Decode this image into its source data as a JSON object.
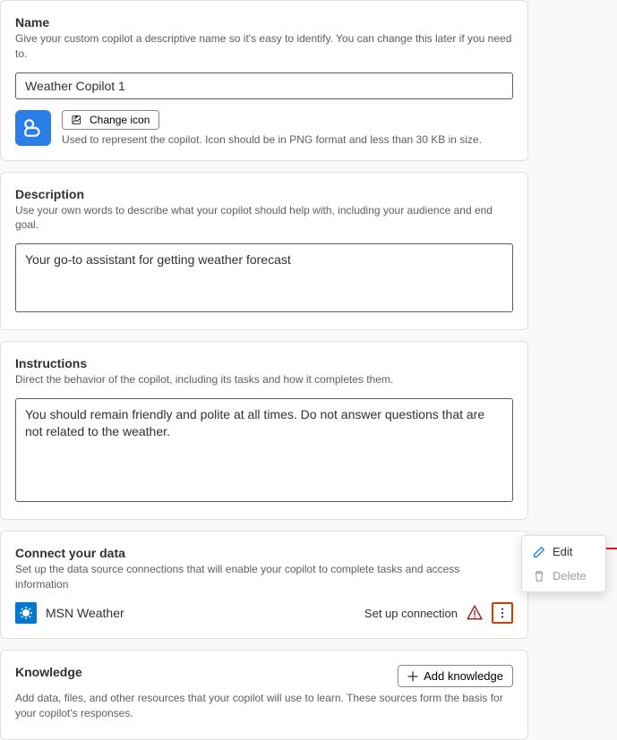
{
  "name_section": {
    "title": "Name",
    "desc": "Give your custom copilot a descriptive name so it's easy to identify. You can change this later if you need to.",
    "value": "Weather Copilot 1",
    "change_icon_label": "Change icon",
    "icon_note": "Used to represent the copilot. Icon should be in PNG format and less than 30 KB in size."
  },
  "description_section": {
    "title": "Description",
    "desc": "Use your own words to describe what your copilot should help with, including your audience and end goal.",
    "value": "Your go-to assistant for getting weather forecast"
  },
  "instructions_section": {
    "title": "Instructions",
    "desc": "Direct the behavior of the copilot, including its tasks and how it completes them.",
    "value": "You should remain friendly and polite at all times. Do not answer questions that are not related to the weather."
  },
  "connect_section": {
    "title": "Connect your data",
    "desc": "Set up the data source connections that will enable your copilot to complete tasks and access information",
    "item_label": "MSN Weather",
    "status": "Set up connection"
  },
  "knowledge_section": {
    "title": "Knowledge",
    "desc": "Add data, files, and other resources that your copilot will use to learn. These sources form the basis for your copilot's responses.",
    "add_label": "Add knowledge"
  },
  "context_menu": {
    "edit": "Edit",
    "delete": "Delete"
  }
}
